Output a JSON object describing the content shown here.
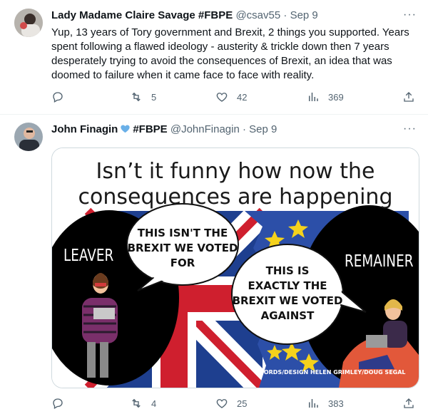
{
  "tweets": [
    {
      "display_name": "Lady Madame Claire Savage #FBPE",
      "handle": "@csav55",
      "sep": "·",
      "date": "Sep 9",
      "more": "···",
      "text": "Yup, 13 years of Tory government and Brexit, 2 things you supported. Years spent following a flawed ideology - austerity & trickle down then 7 years desperately trying to avoid the consequences of Brexit, an idea that was doomed to failure when it came face to face with reality.",
      "reply_count": "",
      "retweets": "5",
      "likes": "42",
      "views": "369"
    },
    {
      "display_name": "John Finagin",
      "name_tag": "#FBPE",
      "handle": "@JohnFinagin",
      "sep": "·",
      "date": "Sep 9",
      "more": "···",
      "reply_count": "",
      "retweets": "4",
      "likes": "25",
      "views": "383",
      "verified_color": "#6ab0e8",
      "image": {
        "title_line1": "Isn’t it funny how now the",
        "title_line2": "consequences are happening",
        "leaver_label": "LEAVER",
        "remainer_label": "REMAINER",
        "bubble_left": [
          "THIS ISN'T THE",
          "BREXIT WE VOTED",
          "FOR"
        ],
        "bubble_right": [
          "THIS IS",
          "EXACTLY THE",
          "BREXIT WE VOTED",
          "AGAINST"
        ],
        "credit": "WORDS/DESIGN HELEN GRIMLEY/DOUG SEGAL"
      }
    }
  ],
  "colors": {
    "text": "#0f1419",
    "secondary": "#536471",
    "divider": "#eff3f4",
    "union_blue": "#1e3f8f",
    "union_red": "#cf1f2e",
    "eu_blue": "#2c4fa8",
    "eu_star": "#f5d21c"
  }
}
